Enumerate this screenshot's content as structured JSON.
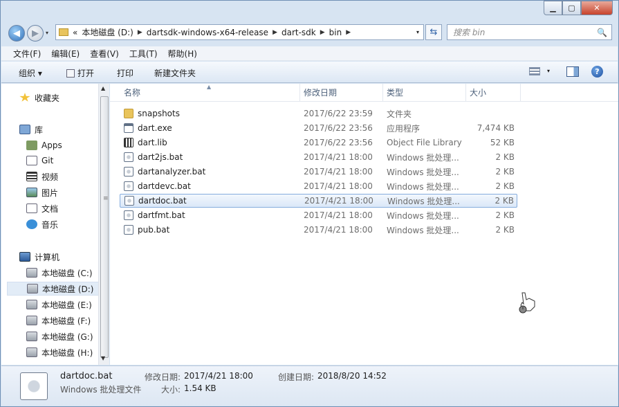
{
  "window": {
    "min_label": "▁",
    "max_label": "▢",
    "close_label": "✕"
  },
  "nav": {
    "back_glyph": "◀",
    "forward_glyph": "▶",
    "history_glyph": "▾",
    "refresh_glyph": "⇆"
  },
  "address": {
    "prefix": "«",
    "segments": [
      "本地磁盘 (D:)",
      "dartsdk-windows-x64-release",
      "dart-sdk",
      "bin"
    ],
    "sep": "▶",
    "dropdown": "▾"
  },
  "search": {
    "placeholder": "搜索 bin",
    "icon": "🔍"
  },
  "menubar": [
    "文件(F)",
    "编辑(E)",
    "查看(V)",
    "工具(T)",
    "帮助(H)"
  ],
  "cmdbar": {
    "organize": "组织 ▾",
    "open": "打开",
    "print": "打印",
    "new_folder": "新建文件夹",
    "help": "?"
  },
  "navpane": {
    "favorites": "收藏夹",
    "libraries": "库",
    "lib_items": [
      "Apps",
      "Git",
      "视频",
      "图片",
      "文档",
      "音乐"
    ],
    "computer": "计算机",
    "drives": [
      "本地磁盘 (C:)",
      "本地磁盘 (D:)",
      "本地磁盘 (E:)",
      "本地磁盘 (F:)",
      "本地磁盘 (G:)",
      "本地磁盘 (H:)"
    ],
    "selected_drive": "本地磁盘 (D:)"
  },
  "columns": {
    "name": "名称",
    "modified": "修改日期",
    "type": "类型",
    "size": "大小"
  },
  "files": [
    {
      "name": "snapshots",
      "modified": "2017/6/22 23:59",
      "type": "文件夹",
      "size": "",
      "icon": "folder"
    },
    {
      "name": "dart.exe",
      "modified": "2017/6/22 23:56",
      "type": "应用程序",
      "size": "7,474 KB",
      "icon": "exe"
    },
    {
      "name": "dart.lib",
      "modified": "2017/6/22 23:56",
      "type": "Object File Library",
      "size": "52 KB",
      "icon": "lib"
    },
    {
      "name": "dart2js.bat",
      "modified": "2017/4/21 18:00",
      "type": "Windows 批处理...",
      "size": "2 KB",
      "icon": "bat"
    },
    {
      "name": "dartanalyzer.bat",
      "modified": "2017/4/21 18:00",
      "type": "Windows 批处理...",
      "size": "2 KB",
      "icon": "bat"
    },
    {
      "name": "dartdevc.bat",
      "modified": "2017/4/21 18:00",
      "type": "Windows 批处理...",
      "size": "2 KB",
      "icon": "bat"
    },
    {
      "name": "dartdoc.bat",
      "modified": "2017/4/21 18:00",
      "type": "Windows 批处理...",
      "size": "2 KB",
      "icon": "bat"
    },
    {
      "name": "dartfmt.bat",
      "modified": "2017/4/21 18:00",
      "type": "Windows 批处理...",
      "size": "2 KB",
      "icon": "bat"
    },
    {
      "name": "pub.bat",
      "modified": "2017/4/21 18:00",
      "type": "Windows 批处理...",
      "size": "2 KB",
      "icon": "bat"
    }
  ],
  "selected_file": "dartdoc.bat",
  "status": {
    "name": "dartdoc.bat",
    "type": "Windows 批处理文件",
    "modified_label": "修改日期:",
    "modified": "2017/4/21 18:00",
    "created_label": "创建日期:",
    "created": "2018/8/20 14:52",
    "size_label": "大小:",
    "size": "1.54 KB"
  },
  "colors": {
    "accent": "#84acdd",
    "window_bg": "#d7e4f2",
    "close": "#c7432c"
  }
}
